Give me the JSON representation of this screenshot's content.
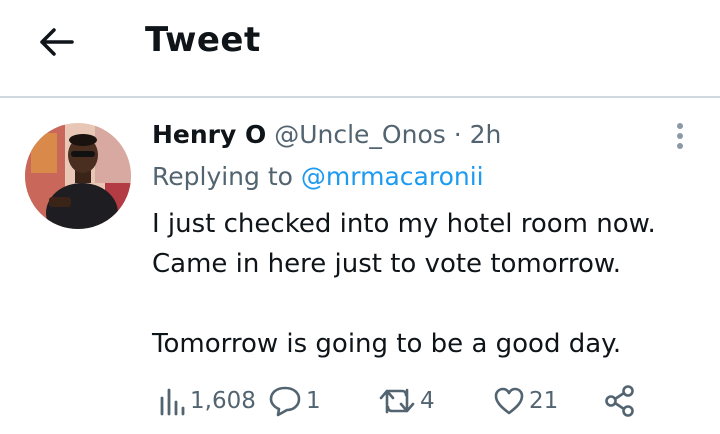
{
  "header": {
    "title": "Tweet"
  },
  "tweet": {
    "author_name": "Henry O",
    "author_handle": "@Uncle_Onos",
    "separator": "·",
    "time": "2h",
    "replying_prefix": "Replying to",
    "replying_to": "@mrmacaronii",
    "text": "I just checked into my hotel room now.\nCame in here just to vote tomorrow.\n\nTomorrow is going to be a good day."
  },
  "actions": {
    "views": "1,608",
    "replies": "1",
    "retweets": "4",
    "likes": "21"
  },
  "colors": {
    "text": "#0f1419",
    "muted": "#536471",
    "link": "#1d9bf0",
    "divider": "#cfd9de"
  },
  "icons": [
    "back-arrow-icon",
    "more-vertical-icon",
    "views-icon",
    "reply-icon",
    "retweet-icon",
    "like-icon",
    "share-icon"
  ]
}
